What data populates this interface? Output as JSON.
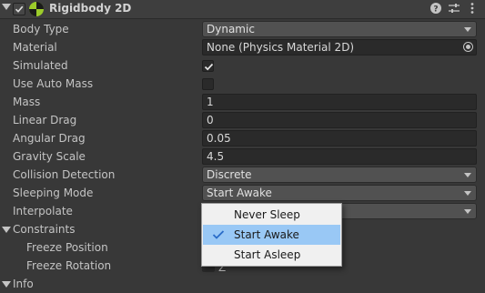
{
  "header": {
    "title": "Rigidbody 2D",
    "help_icon": "help-icon",
    "presets_icon": "presets-icon",
    "menu_icon": "kebab-menu-icon"
  },
  "fields": {
    "body_type": {
      "label": "Body Type",
      "value": "Dynamic"
    },
    "material": {
      "label": "Material",
      "value": "None (Physics Material 2D)"
    },
    "simulated": {
      "label": "Simulated",
      "checked": true
    },
    "use_auto_mass": {
      "label": "Use Auto Mass",
      "checked": false
    },
    "mass": {
      "label": "Mass",
      "value": "1"
    },
    "linear_drag": {
      "label": "Linear Drag",
      "value": "0"
    },
    "angular_drag": {
      "label": "Angular Drag",
      "value": "0.05"
    },
    "gravity_scale": {
      "label": "Gravity Scale",
      "value": "4.5"
    },
    "collision_detection": {
      "label": "Collision Detection",
      "value": "Discrete"
    },
    "sleeping_mode": {
      "label": "Sleeping Mode",
      "value": "Start Awake"
    },
    "interpolate": {
      "label": "Interpolate"
    }
  },
  "constraints": {
    "label": "Constraints",
    "freeze_position": "Freeze Position",
    "freeze_rotation": "Freeze Rotation",
    "rotation_axis": "Z"
  },
  "info": {
    "label": "Info"
  },
  "sleep_popup": {
    "options": [
      "Never Sleep",
      "Start Awake",
      "Start Asleep"
    ],
    "selected": "Start Awake"
  },
  "colors": {
    "background": "#383838",
    "field": "#2a2a2a",
    "dropdown": "#515151",
    "highlight": "#99c8f5"
  }
}
